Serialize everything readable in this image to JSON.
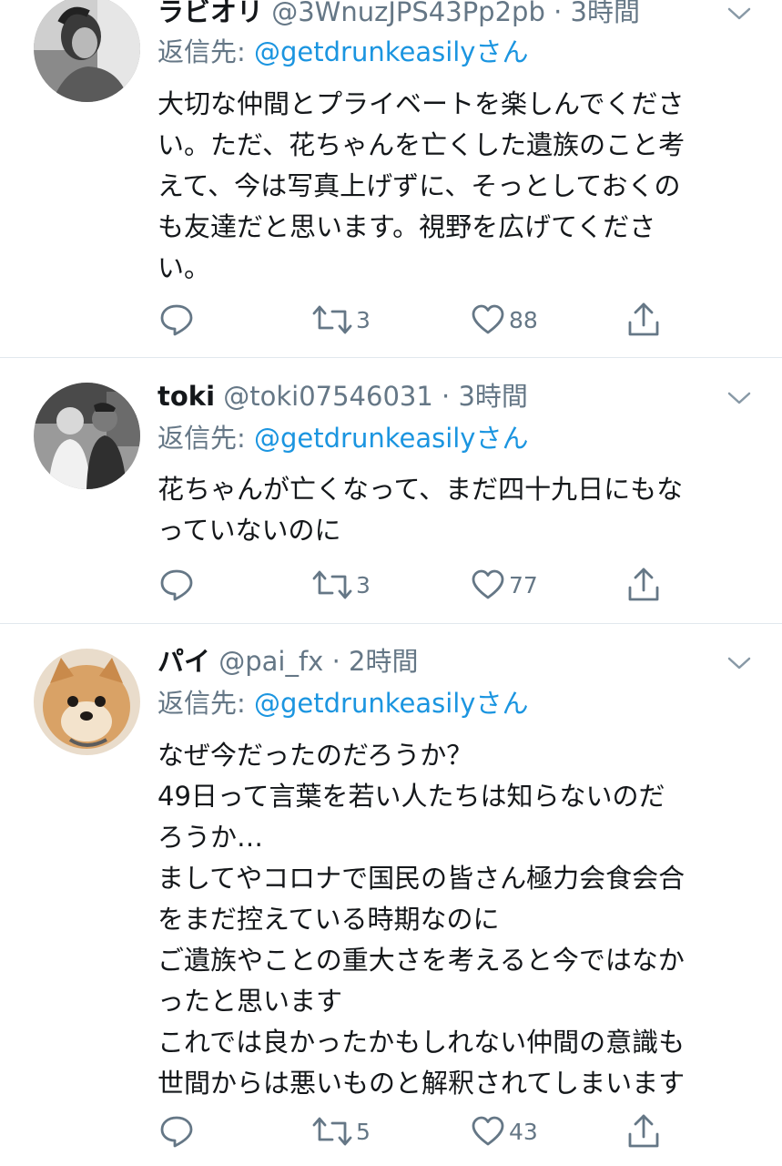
{
  "tweets": [
    {
      "name": "ラビオリ",
      "handle": "@3WnuzJPS43Pp2pb",
      "dot": "·",
      "time": "3時間",
      "reply_prefix": "返信先: ",
      "reply_mention": "@getdrunkeasily",
      "reply_suffix": "さん",
      "lines": [
        "大切な仲間とプライベートを楽しんでくださ",
        "い。ただ、花ちゃんを亡くした遺族のこと考",
        "えて、今は写真上げずに、そっとしておくの",
        "も友達だと思います。視野を広げてくださ",
        "い。"
      ],
      "retweets": "3",
      "likes": "88",
      "avatar_icon": "user-avatar-person-icon"
    },
    {
      "name": "toki",
      "handle": "@toki07546031",
      "dot": "·",
      "time": "3時間",
      "reply_prefix": "返信先: ",
      "reply_mention": "@getdrunkeasily",
      "reply_suffix": "さん",
      "lines": [
        "花ちゃんが亡くなって、まだ四十九日にもな",
        "っていないのに"
      ],
      "retweets": "3",
      "likes": "77",
      "avatar_icon": "user-avatar-two-people-icon"
    },
    {
      "name": "パイ",
      "handle": "@pai_fx",
      "dot": "·",
      "time": "2時間",
      "reply_prefix": "返信先: ",
      "reply_mention": "@getdrunkeasily",
      "reply_suffix": "さん",
      "lines": [
        "なぜ今だったのだろうか？",
        "49日って言葉を若い人たちは知らないのだ",
        "ろうか…",
        "ましてやコロナで国民の皆さん極力会食会合",
        "をまだ控えている時期なのに",
        "ご遺族やことの重大さを考えると今ではなか",
        "ったと思います",
        "これでは良かったかもしれない仲間の意識も",
        "世間からは悪いものと解釈されてしまいます"
      ],
      "retweets": "5",
      "likes": "43",
      "avatar_icon": "user-avatar-dog-icon"
    }
  ],
  "colors": {
    "text": "#14171a",
    "secondary": "#657786",
    "link": "#1b95e0",
    "divider": "#e1e8ed"
  },
  "icons": {
    "reply": "reply-icon",
    "retweet": "retweet-icon",
    "like": "heart-icon",
    "share": "share-icon",
    "more": "chevron-down-icon"
  }
}
